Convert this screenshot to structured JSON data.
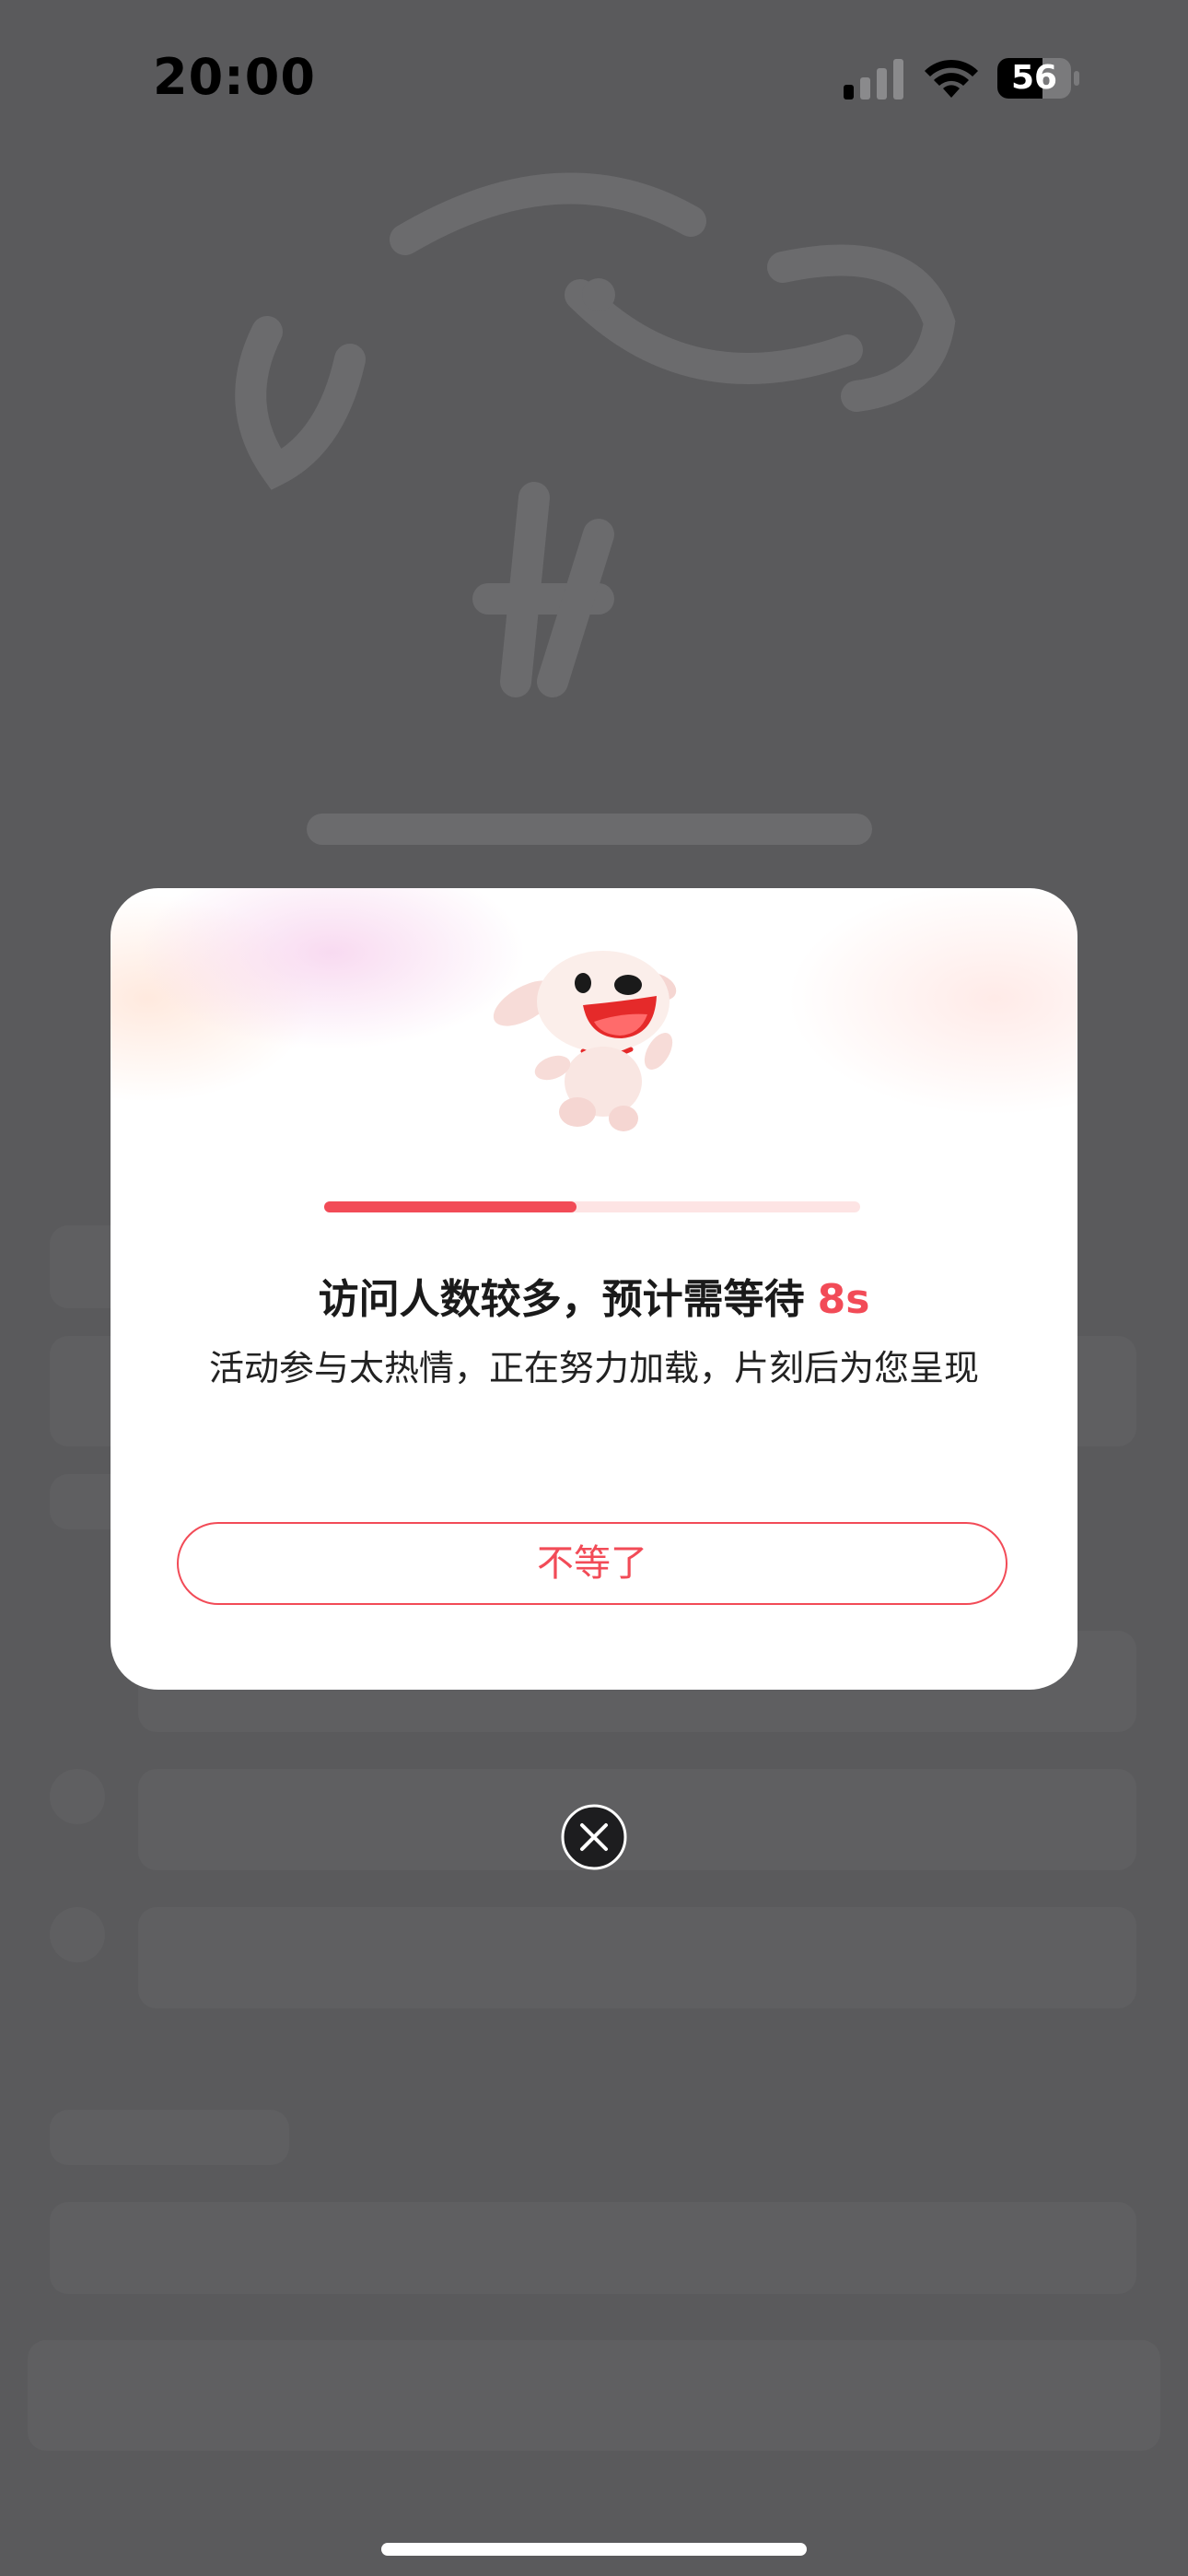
{
  "status_bar": {
    "time": "20:00",
    "battery_level": "56",
    "signal_icon": "cellular-signal-icon",
    "wifi_icon": "wifi-icon",
    "battery_icon": "battery-icon"
  },
  "background": {
    "logo_icon": "jd-logo-icon"
  },
  "dialog": {
    "mascot_icon": "joy-dog-mascot-icon",
    "progress": 0.47,
    "headline": "访问人数较多，预计需等待",
    "countdown": "8s",
    "message": "活动参与太热情，正在努力加载，片刻后为您呈现",
    "cancel_label": "不等了"
  },
  "close_icon": "close-icon",
  "colors": {
    "accent": "#f24b57",
    "overlay": "#5a5a5c",
    "dialog_bg": "#ffffff",
    "progress_track": "#fde4e4"
  }
}
